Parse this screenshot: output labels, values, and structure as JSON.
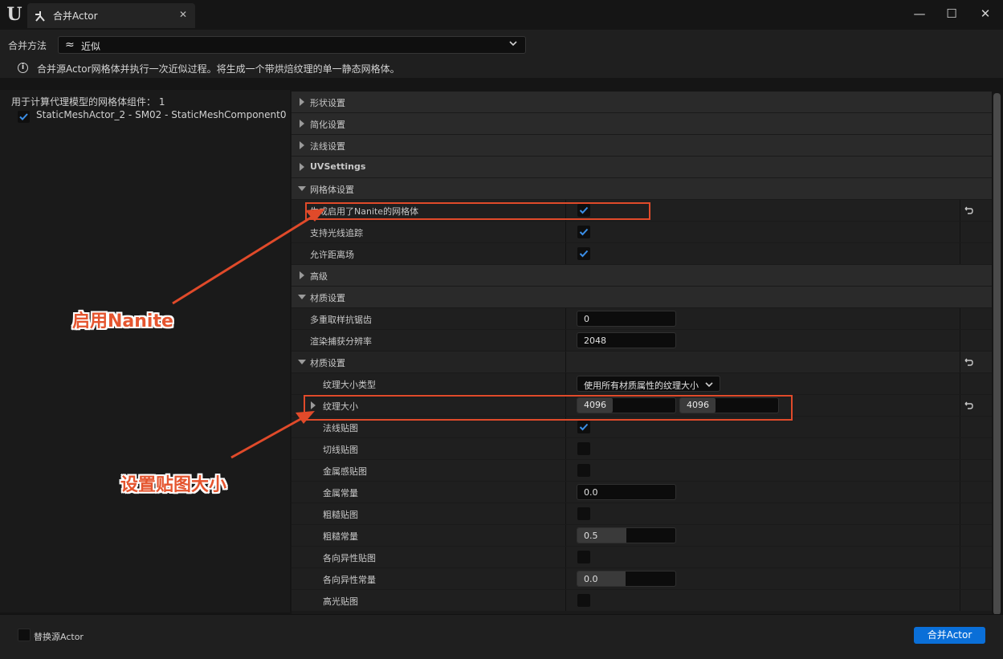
{
  "window": {
    "tab_title": "合并Actor",
    "close_label": "✕",
    "minimize_label": "—",
    "maximize_label": "☐",
    "window_close_label": "✕"
  },
  "method": {
    "label": "合并方法",
    "value": "近似",
    "icon": "approx-icon",
    "info": "合并源Actor网格体并执行一次近似过程。将生成一个带烘焙纹理的单一静态网格体。"
  },
  "left_panel": {
    "components_label": "用于计算代理模型的网格体组件： 1",
    "component_label": "StaticMeshActor_2 - SM02 - StaticMeshComponent0",
    "component_checked": true
  },
  "categories": {
    "shape": "形状设置",
    "simplify": "简化设置",
    "normal": "法线设置",
    "uv": "UVSettings",
    "mesh": "网格体设置",
    "advanced": "高级",
    "material": "材质设置",
    "material2": "材质设置"
  },
  "mesh_props": {
    "nanite": "生成启用了Nanite的网格体",
    "raytracing": "支持光线追踪",
    "distance_field": "允许距离场"
  },
  "material_props": {
    "multisample": "多重取样抗锯齿",
    "multisample_value": "0",
    "render_res": "渲染捕获分辨率",
    "render_res_value": "2048"
  },
  "material2_props": {
    "texture_size_type": "纹理大小类型",
    "texture_size_type_value": "使用所有材质属性的纹理大小",
    "texture_size": "纹理大小",
    "texture_size_x": "4096",
    "texture_size_y": "4096",
    "normal_map": "法线贴图",
    "tangent_map": "切线贴图",
    "metallic_map": "金属感贴图",
    "metallic_const": "金属常量",
    "metallic_const_value": "0.0",
    "roughness_map": "粗糙贴图",
    "roughness_const": "粗糙常量",
    "roughness_const_value": "0.5",
    "roughness_fraction": 0.5,
    "aniso_map": "各向异性贴图",
    "aniso_const": "各向异性常量",
    "aniso_const_value": "0.0",
    "specular_map": "高光贴图"
  },
  "footer": {
    "replace_label": "替换源Actor",
    "merge_button": "合并Actor"
  },
  "annotations": {
    "nanite_note": "启用Nanite",
    "texture_note": "设置贴图大小"
  },
  "colors": {
    "accent": "#0a6fd8",
    "annotation": "#e04a2a",
    "check": "#3b8fe8"
  }
}
